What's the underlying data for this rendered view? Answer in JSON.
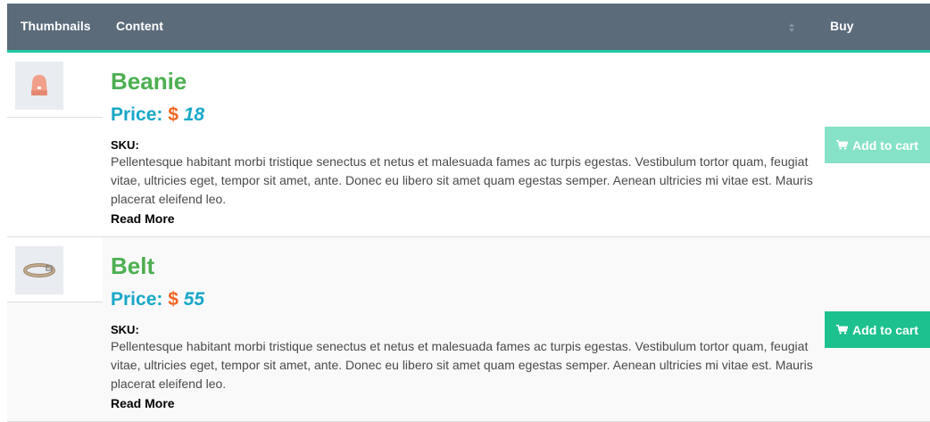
{
  "table": {
    "headers": {
      "thumbnails": "Thumbnails",
      "content": "Content",
      "buy": "Buy"
    },
    "sort_icon": "sort-icon",
    "colors": {
      "header_bg": "#5b6b7a",
      "header_accent": "#21c7a2",
      "title": "#4caf50",
      "price": "#17a8c7",
      "currency": "#f26522",
      "button": "#1dc18f",
      "button_disabled": "#85e2c7"
    }
  },
  "products": [
    {
      "name": "Beanie",
      "price_label": "Price:",
      "currency": "$",
      "price": "18",
      "sku_label": "SKU:",
      "description": "Pellentesque habitant morbi tristique senectus et netus et malesuada fames ac turpis egestas. Vestibulum tortor quam, feugiat vitae, ultricies eget, tempor sit amet, ante. Donec eu libero sit amet quam egestas semper. Aenean ultricies mi vitae est. Mauris placerat eleifend leo.",
      "read_more": "Read More",
      "button_label": "Add to cart",
      "button_state": "disabled",
      "thumbnail_icon": "beanie-icon"
    },
    {
      "name": "Belt",
      "price_label": "Price:",
      "currency": "$",
      "price": "55",
      "sku_label": "SKU:",
      "description": "Pellentesque habitant morbi tristique senectus et netus et malesuada fames ac turpis egestas. Vestibulum tortor quam, feugiat vitae, ultricies eget, tempor sit amet, ante. Donec eu libero sit amet quam egestas semper. Aenean ultricies mi vitae est. Mauris placerat eleifend leo.",
      "read_more": "Read More",
      "button_label": "Add to cart",
      "button_state": "active",
      "thumbnail_icon": "belt-icon"
    }
  ]
}
